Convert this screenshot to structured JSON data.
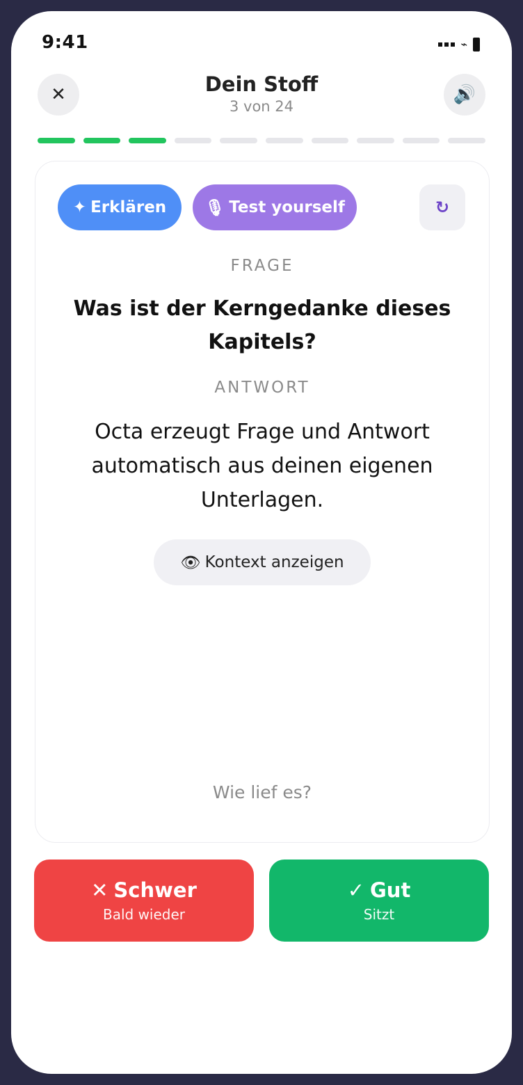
{
  "status_bar": {
    "time": "9:41",
    "wifi_glyph": "⌁"
  },
  "header": {
    "close_glyph": "✕",
    "sound_glyph": "🔊",
    "title": "Dein Stoff",
    "subtitle": "3 von 24"
  },
  "progress": {
    "completed": 3,
    "total_segments": 10,
    "color_done": "#22c55e",
    "color_todo": "#e6e6ea"
  },
  "card": {
    "explain": {
      "glyph": "✦",
      "label": "Erklären",
      "color": "#4f8ff7"
    },
    "test": {
      "glyph": "🎙",
      "label": "Test yourself",
      "color": "#9d78e6"
    },
    "refresh_glyph": "↻",
    "question_label": "FRAGE",
    "question": "Was ist der Kerngedanke dieses Kapitels?",
    "answer_label": "ANTWORT",
    "answer": "Octa erzeugt Frage und Antwort automatisch aus deinen eigenen Unterlagen.",
    "context": {
      "glyph": "👁",
      "label": "Kontext anzeigen"
    },
    "feedback_prompt": "Wie lief es?"
  },
  "buttons": {
    "hard": {
      "glyph": "✕",
      "label": "Schwer",
      "sublabel": "Bald wieder",
      "color": "#ef4444"
    },
    "good": {
      "glyph": "✓",
      "label": "Gut",
      "sublabel": "Sitzt",
      "color": "#12b76a"
    }
  }
}
